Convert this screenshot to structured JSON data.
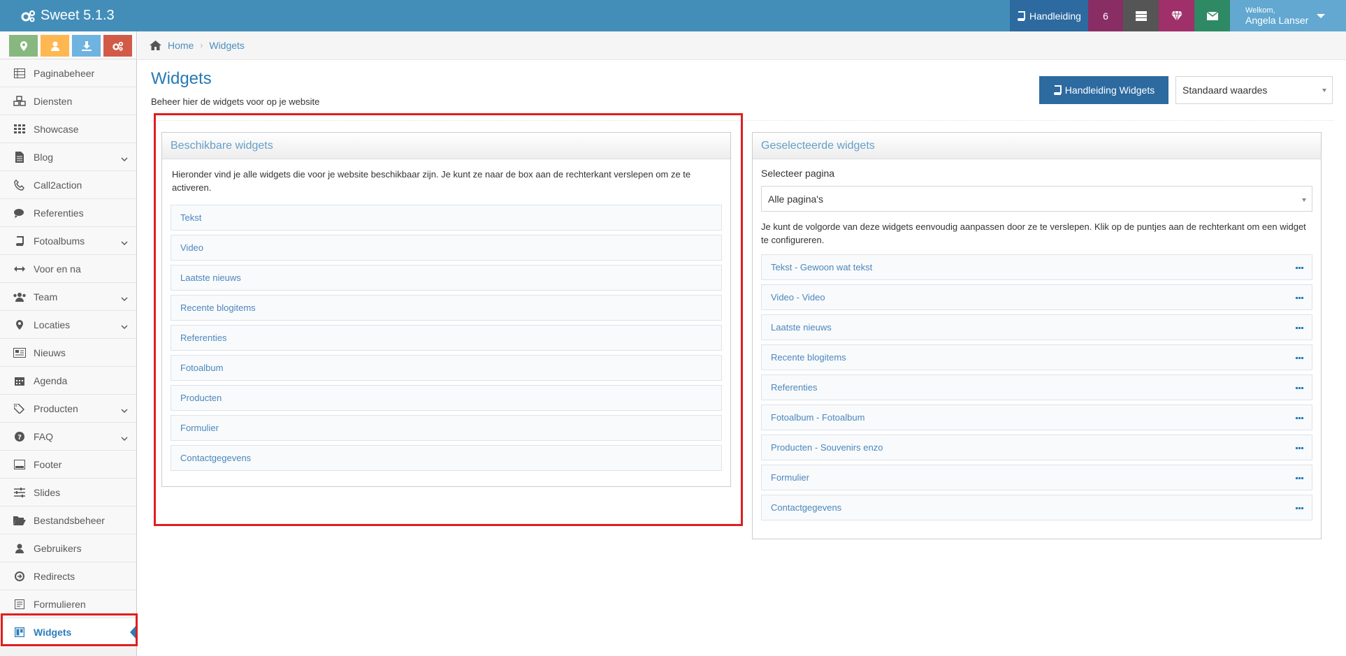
{
  "app": {
    "title": "Sweet 5.1.3"
  },
  "topnav": {
    "manual_label": "Handleiding",
    "notification_count": "6",
    "welcome": "Welkom,",
    "user_name": "Angela Lanser"
  },
  "sidebar": {
    "items": [
      {
        "label": "Paginabeheer",
        "icon": "table-icon",
        "submenu": false
      },
      {
        "label": "Diensten",
        "icon": "cubes-icon",
        "submenu": false
      },
      {
        "label": "Showcase",
        "icon": "grid-icon",
        "submenu": false
      },
      {
        "label": "Blog",
        "icon": "file-icon",
        "submenu": true
      },
      {
        "label": "Call2action",
        "icon": "phone-icon",
        "submenu": false
      },
      {
        "label": "Referenties",
        "icon": "comments-icon",
        "submenu": false
      },
      {
        "label": "Fotoalbums",
        "icon": "book-icon",
        "submenu": true
      },
      {
        "label": "Voor en na",
        "icon": "arrows-h-icon",
        "submenu": false
      },
      {
        "label": "Team",
        "icon": "users-icon",
        "submenu": true
      },
      {
        "label": "Locaties",
        "icon": "map-marker-icon",
        "submenu": true
      },
      {
        "label": "Nieuws",
        "icon": "newspaper-icon",
        "submenu": false
      },
      {
        "label": "Agenda",
        "icon": "calendar-icon",
        "submenu": false
      },
      {
        "label": "Producten",
        "icon": "tags-icon",
        "submenu": true
      },
      {
        "label": "FAQ",
        "icon": "question-icon",
        "submenu": true
      },
      {
        "label": "Footer",
        "icon": "footer-icon",
        "submenu": false
      },
      {
        "label": "Slides",
        "icon": "sliders-icon",
        "submenu": false
      },
      {
        "label": "Bestandsbeheer",
        "icon": "folder-open-icon",
        "submenu": false
      },
      {
        "label": "Gebruikers",
        "icon": "user-icon",
        "submenu": false
      },
      {
        "label": "Redirects",
        "icon": "arrow-circle-icon",
        "submenu": false
      },
      {
        "label": "Formulieren",
        "icon": "form-icon",
        "submenu": false
      },
      {
        "label": "Widgets",
        "icon": "widgets-icon",
        "submenu": false,
        "active": true
      }
    ]
  },
  "breadcrumb": {
    "home": "Home",
    "current": "Widgets"
  },
  "page": {
    "title": "Widgets",
    "subtitle": "Beheer hier de widgets voor op je website",
    "manual_button": "Handleiding Widgets",
    "defaults_select": "Standaard waardes"
  },
  "available": {
    "title": "Beschikbare widgets",
    "description": "Hieronder vind je alle widgets die voor je website beschikbaar zijn. Je kunt ze naar de box aan de rechterkant verslepen om ze te activeren.",
    "items": [
      "Tekst",
      "Video",
      "Laatste nieuws",
      "Recente blogitems",
      "Referenties",
      "Fotoalbum",
      "Producten",
      "Formulier",
      "Contactgegevens"
    ]
  },
  "selected": {
    "title": "Geselecteerde widgets",
    "page_label": "Selecteer pagina",
    "page_value": "Alle pagina's",
    "description": "Je kunt de volgorde van deze widgets eenvoudig aanpassen door ze te verslepen. Klik op de puntjes aan de rechterkant om een widget te configureren.",
    "items": [
      "Tekst - Gewoon wat tekst",
      "Video - Video",
      "Laatste nieuws",
      "Recente blogitems",
      "Referenties",
      "Fotoalbum - Fotoalbum",
      "Producten - Souvenirs enzo",
      "Formulier",
      "Contactgegevens"
    ]
  },
  "colors": {
    "topbar": "#438eb9",
    "accent": "#2c6aa0",
    "link": "#4a87be",
    "highlight": "#e01e1e"
  }
}
